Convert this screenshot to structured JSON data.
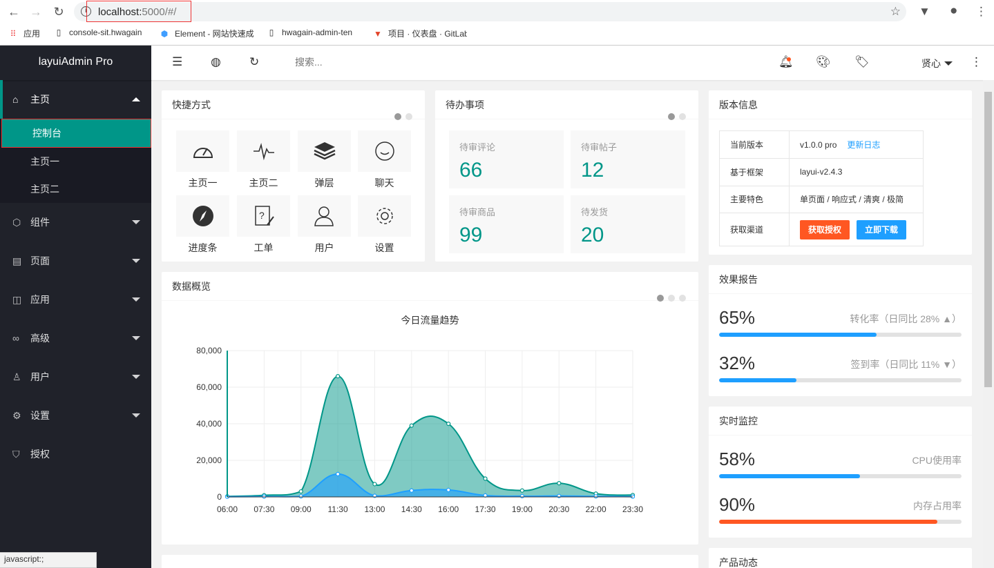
{
  "browser": {
    "url_host": "localhost:",
    "url_rest": "5000/#/",
    "bookmarks": [
      {
        "icon": "apps-grid-icon",
        "label": "应用"
      },
      {
        "icon": "page-icon",
        "label": "console-sit.hwagain"
      },
      {
        "icon": "element-icon",
        "label": "Element - 网站快速成"
      },
      {
        "icon": "page-icon",
        "label": "hwagain-admin-ten"
      },
      {
        "icon": "gitlab-icon",
        "label": "项目 · 仪表盘 · GitLab"
      }
    ],
    "status_text": "javascript:;"
  },
  "sidebar": {
    "logo": "layuiAdmin Pro",
    "home": {
      "label": "主页",
      "icon": "home-icon"
    },
    "sub_items": [
      "控制台",
      "主页一",
      "主页二"
    ],
    "items": [
      {
        "label": "组件",
        "icon": "cube-icon"
      },
      {
        "label": "页面",
        "icon": "template-icon"
      },
      {
        "label": "应用",
        "icon": "app-icon"
      },
      {
        "label": "高级",
        "icon": "senior-icon"
      },
      {
        "label": "用户",
        "icon": "user-icon"
      },
      {
        "label": "设置",
        "icon": "settings-icon"
      },
      {
        "label": "授权",
        "icon": "auth-icon"
      }
    ]
  },
  "header": {
    "search_placeholder": "搜索...",
    "user_name": "贤心"
  },
  "quick": {
    "title": "快捷方式",
    "items": [
      {
        "label": "主页一",
        "icon": "dashboard-icon"
      },
      {
        "label": "主页二",
        "icon": "chart-pulse-icon"
      },
      {
        "label": "弹层",
        "icon": "layers-icon"
      },
      {
        "label": "聊天",
        "icon": "chat-smile-icon"
      },
      {
        "label": "进度条",
        "icon": "compass-icon"
      },
      {
        "label": "工单",
        "icon": "help-doc-icon"
      },
      {
        "label": "用户",
        "icon": "users-icon"
      },
      {
        "label": "设置",
        "icon": "gear-icon"
      }
    ]
  },
  "todo": {
    "title": "待办事项",
    "items": [
      {
        "label": "待审评论",
        "value": "66"
      },
      {
        "label": "待审帖子",
        "value": "12"
      },
      {
        "label": "待审商品",
        "value": "99"
      },
      {
        "label": "待发货",
        "value": "20"
      }
    ]
  },
  "version": {
    "title": "版本信息",
    "rows": [
      {
        "k": "当前版本",
        "v": "v1.0.0 pro",
        "link": "更新日志"
      },
      {
        "k": "基于框架",
        "v": "layui-v2.4.3"
      },
      {
        "k": "主要特色",
        "v": "单页面 / 响应式 / 清爽 / 极简"
      },
      {
        "k": "获取渠道",
        "btn1": "获取授权",
        "btn2": "立即下载"
      }
    ],
    "btn1_color": "#ff5722",
    "btn2_color": "#1e9fff"
  },
  "effect": {
    "title": "效果报告",
    "items": [
      {
        "pct": "65%",
        "desc": "转化率（日同比 28%",
        "arrow": "▲",
        "suffix": "）",
        "value": 0.65,
        "color": "#1e9fff"
      },
      {
        "pct": "32%",
        "desc": "签到率（日同比 11%",
        "arrow": "▼",
        "suffix": "）",
        "value": 0.32,
        "color": "#1e9fff"
      }
    ]
  },
  "monitor": {
    "title": "实时监控",
    "items": [
      {
        "pct": "58%",
        "desc": "CPU使用率",
        "value": 0.58,
        "color": "#1e9fff"
      },
      {
        "pct": "90%",
        "desc": "内存占用率",
        "value": 0.9,
        "color": "#ff5722"
      }
    ]
  },
  "product": {
    "title": "产品动态"
  },
  "overview": {
    "title": "数据概览"
  },
  "chart_data": {
    "type": "area",
    "title": "今日流量趋势",
    "x": [
      "06:00",
      "07:30",
      "09:00",
      "11:30",
      "13:00",
      "14:30",
      "16:00",
      "17:30",
      "19:00",
      "20:30",
      "22:00",
      "23:30"
    ],
    "series": [
      {
        "values": [
          300,
          900,
          3000,
          66000,
          7000,
          39000,
          40000,
          10000,
          3500,
          7500,
          1800,
          1000
        ],
        "color": "#009688"
      },
      {
        "values": [
          100,
          200,
          300,
          12500,
          600,
          3500,
          3800,
          800,
          400,
          500,
          300,
          150
        ],
        "color": "#1e9fff"
      }
    ],
    "ylim": [
      0,
      80000
    ],
    "yticks": [
      "0",
      "20,000",
      "40,000",
      "60,000",
      "80,000"
    ],
    "grid": true
  }
}
